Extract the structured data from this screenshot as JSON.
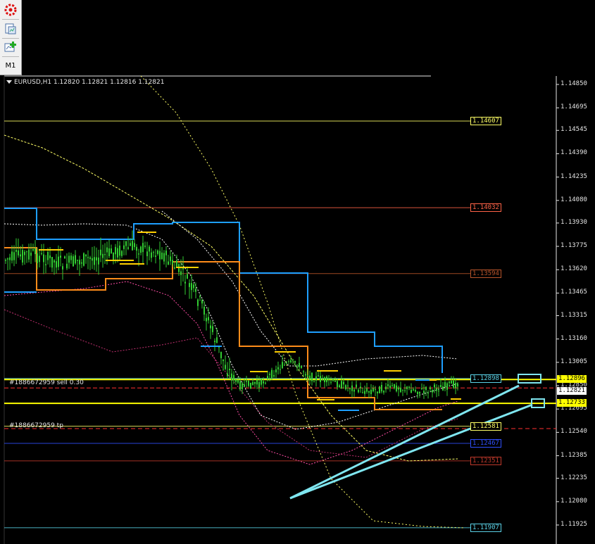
{
  "toolbar": {
    "buttons": [
      {
        "name": "app-logo-icon"
      },
      {
        "name": "chart-template-icon"
      },
      {
        "name": "new-chart-icon"
      }
    ],
    "timeframe": "M1"
  },
  "chart": {
    "symbol_info": "EURUSD,H1  1.12820 1.12821 1.12816 1.12821",
    "order_label": "#1886672959 sell 0.30",
    "tp_label": "#1886672959 tp",
    "price_axis": [
      "1.14850",
      "1.14695",
      "1.14545",
      "1.14390",
      "1.14235",
      "1.14080",
      "1.13930",
      "1.13775",
      "1.13620",
      "1.13465",
      "1.13315",
      "1.13160",
      "1.13005",
      "1.12850",
      "1.12695",
      "1.12540",
      "1.12385",
      "1.12235",
      "1.12080",
      "1.11925"
    ],
    "ask_price": "1.12896",
    "bid_price": "1.12821",
    "order_price": "1.12733",
    "level_tags": [
      {
        "value": "1.14607",
        "color": "#ffff66"
      },
      {
        "value": "1.14032",
        "color": "#ff6347"
      },
      {
        "value": "1.13594",
        "color": "#b8552b"
      },
      {
        "value": "1.12898",
        "color": "#5ad1e6"
      },
      {
        "value": "1.12581",
        "color": "#ffff66"
      },
      {
        "value": "1.12467",
        "color": "#3050ff"
      },
      {
        "value": "1.12351",
        "color": "#c0392b"
      },
      {
        "value": "1.11907",
        "color": "#5ad1e6"
      }
    ],
    "colors": {
      "candle": "#32cd32",
      "ask_line": "#ffff00",
      "bid_line": "#ff3030",
      "channel_blue": "#1e9fff",
      "channel_orange": "#ff8c1a",
      "arrow": "#7fe6f0"
    }
  }
}
